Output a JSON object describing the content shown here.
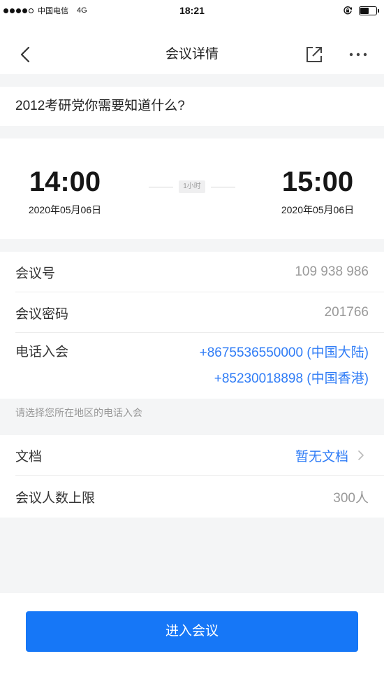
{
  "status_bar": {
    "signal_level": 4,
    "signal_max": 5,
    "carrier": "中国电信",
    "network": "4G",
    "time": "18:21",
    "battery_level": 0.55,
    "icons": [
      "signal-strength-icon",
      "rotation-lock-icon",
      "battery-icon"
    ]
  },
  "nav": {
    "title": "会议详情",
    "icons": {
      "back": "chevron-left-icon",
      "share": "share-icon",
      "more": "more-icon"
    }
  },
  "meeting": {
    "title": "2012考研党你需要知道什么?"
  },
  "schedule": {
    "start": {
      "time": "14:00",
      "date": "2020年05月06日"
    },
    "duration": "1小时",
    "end": {
      "time": "15:00",
      "date": "2020年05月06日"
    }
  },
  "details": {
    "meeting_id": {
      "label": "会议号",
      "value": "109 938 986"
    },
    "password": {
      "label": "会议密码",
      "value": "201766"
    },
    "dial_in": {
      "label": "电话入会",
      "numbers": [
        "+8675536550000 (中国大陆)",
        "+85230018898 (中国香港)"
      ]
    },
    "dial_in_hint": "请选择您所在地区的电话入会"
  },
  "extras": {
    "documents": {
      "label": "文档",
      "value": "暂无文档",
      "icon": "chevron-right-icon"
    },
    "capacity": {
      "label": "会议人数上限",
      "value": "300人"
    }
  },
  "join_button": {
    "label": "进入会议"
  },
  "colors": {
    "background": "#f4f5f6",
    "surface": "#ffffff",
    "text_primary": "#333333",
    "text_secondary": "#999999",
    "link": "#2f7cf6",
    "button": "#1677f7",
    "button_text": "#ffffff"
  }
}
